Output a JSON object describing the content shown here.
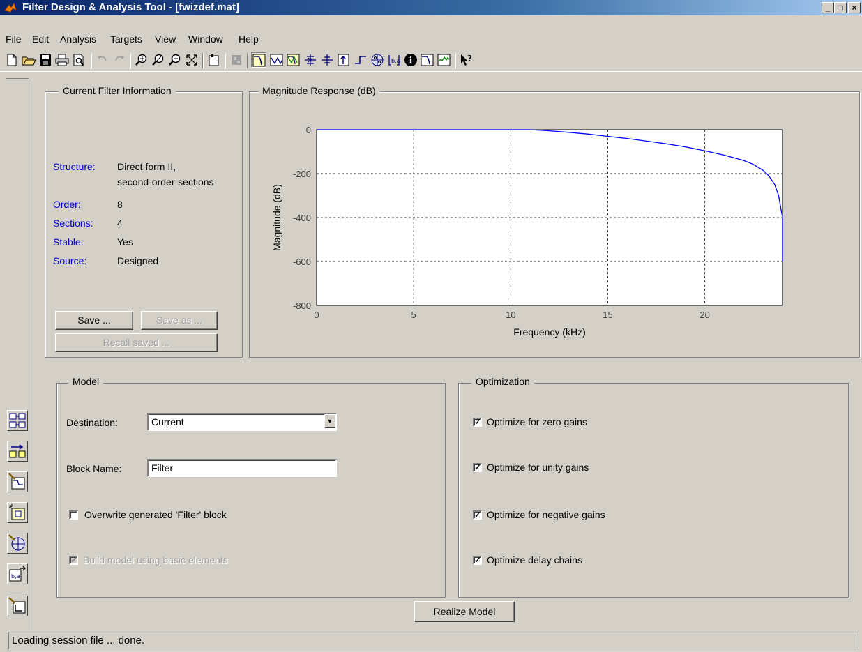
{
  "window": {
    "title": "Filter Design & Analysis Tool -  [fwizdef.mat]",
    "controls": [
      "_",
      "□",
      "×"
    ]
  },
  "menu": [
    "File",
    "Edit",
    "Analysis",
    "Targets",
    "View",
    "Window",
    "Help"
  ],
  "toolbar_icons": [
    "new-file-icon",
    "open-folder-icon",
    "save-icon",
    "print-icon",
    "print-preview-icon",
    "undo-icon",
    "redo-icon",
    "zoom-in-icon",
    "zoom-out-icon",
    "zoom-x-icon",
    "full-view-icon",
    "new-figure-icon",
    "sync-icon",
    "magnitude-response-icon",
    "phase-response-icon",
    "magnitude-phase-icon",
    "group-delay-icon",
    "phase-delay-icon",
    "impulse-response-icon",
    "step-response-icon",
    "pole-zero-icon",
    "coefficients-icon",
    "filter-info-icon",
    "magnitude-estimate-icon",
    "noise-power-icon",
    "whats-this-icon"
  ],
  "filter_info": {
    "legend": "Current Filter Information",
    "rows": [
      {
        "label": "Structure:",
        "value": "Direct form II,"
      },
      {
        "label": "",
        "value": "second-order-sections"
      },
      {
        "label": "Order:",
        "value": "8"
      },
      {
        "label": "Sections:",
        "value": "4"
      },
      {
        "label": "Stable:",
        "value": "Yes"
      },
      {
        "label": "Source:",
        "value": "Designed"
      }
    ],
    "save_label": "Save ...",
    "save_as_label": "Save as ...",
    "recall_label": "Recall saved ..."
  },
  "plot_panel": {
    "legend": "Magnitude Response (dB)"
  },
  "chart_data": {
    "type": "line",
    "xlabel": "Frequency (kHz)",
    "ylabel": "Magnitude (dB)",
    "xlim": [
      0,
      24
    ],
    "ylim": [
      -800,
      0
    ],
    "xticks": [
      0,
      5,
      10,
      15,
      20
    ],
    "yticks": [
      0,
      -200,
      -400,
      -600,
      -800
    ],
    "grid": true,
    "line_color": "#0000ff",
    "x": [
      0,
      2,
      4,
      6,
      8,
      10,
      11,
      12,
      13,
      14,
      15,
      16,
      17,
      18,
      19,
      20,
      21,
      22,
      22.5,
      23,
      23.3,
      23.6,
      23.8,
      23.9,
      24,
      24
    ],
    "y": [
      0,
      0,
      0,
      0,
      0,
      0,
      0,
      -5,
      -12,
      -20,
      -30,
      -40,
      -52,
      -64,
      -78,
      -96,
      -116,
      -140,
      -158,
      -185,
      -210,
      -250,
      -300,
      -350,
      -400,
      -600
    ]
  },
  "model": {
    "legend": "Model",
    "destination_label": "Destination:",
    "destination_value": "Current",
    "block_name_label": "Block Name:",
    "block_name_value": "Filter",
    "overwrite_label": "Overwrite generated 'Filter' block",
    "overwrite_checked": false,
    "build_label": "Build model using basic elements",
    "build_checked": true
  },
  "optimization": {
    "legend": "Optimization",
    "options": [
      {
        "label": "Optimize for zero gains",
        "checked": true
      },
      {
        "label": "Optimize for unity gains",
        "checked": true
      },
      {
        "label": "Optimize for negative gains",
        "checked": true
      },
      {
        "label": "Optimize delay chains",
        "checked": true
      }
    ]
  },
  "realize_label": "Realize Model",
  "side_icons": [
    "transform-filter-icon",
    "convert-structure-icon",
    "design-filter-icon",
    "realize-model-icon",
    "pole-zero-editor-icon",
    "import-filter-icon",
    "multirate-icon"
  ],
  "status": "Loading session file ... done."
}
